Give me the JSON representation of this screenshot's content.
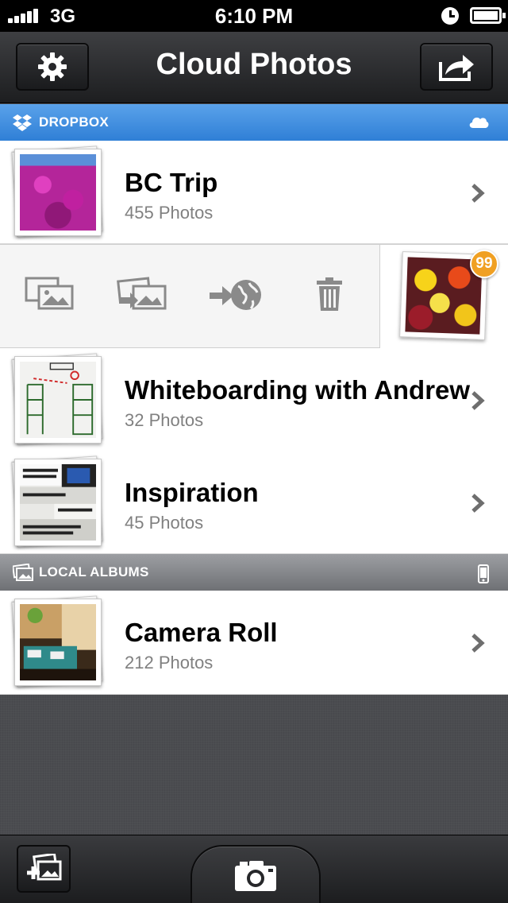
{
  "status_bar": {
    "network": "3G",
    "time": "6:10 PM"
  },
  "nav": {
    "title": "Cloud Photos",
    "left_icon": "gear-icon",
    "right_icon": "share-icon"
  },
  "sections": [
    {
      "label": "DROPBOX",
      "icon": "dropbox-icon",
      "right_icon": "cloud-icon"
    },
    {
      "label": "LOCAL ALBUMS",
      "icon": "album-icon",
      "right_icon": "phone-icon"
    }
  ],
  "albums": [
    {
      "title": "BC Trip",
      "subtitle": "455 Photos"
    },
    {
      "title": "Whiteboarding with Andrew",
      "subtitle": "32 Photos"
    },
    {
      "title": "Inspiration",
      "subtitle": "45 Photos"
    },
    {
      "title": "Camera Roll",
      "subtitle": "212 Photos"
    }
  ],
  "action_row": {
    "actions": [
      "view-photos-icon",
      "move-photos-icon",
      "share-web-icon",
      "trash-icon"
    ],
    "badge_count": "99"
  },
  "toolbar": {
    "left_icon": "add-album-icon",
    "center_icon": "camera-icon"
  },
  "colors": {
    "dropbox_header": "#3a8ae0",
    "local_header": "#85878b",
    "badge": "#f0a023"
  }
}
